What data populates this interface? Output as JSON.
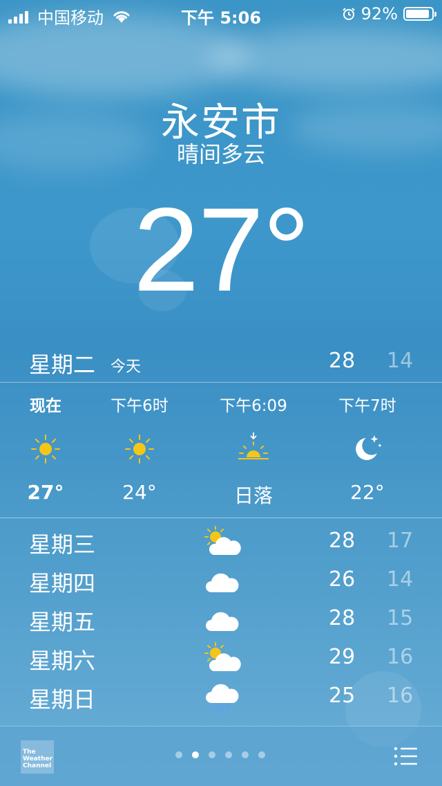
{
  "status_bar": {
    "carrier": "中国移动",
    "time": "下午 5:06",
    "battery": "92%",
    "battery_level": 0.92,
    "signal_bars": 4
  },
  "weather": {
    "city": "永安市",
    "condition": "晴间多云",
    "temperature": "27°"
  },
  "today": {
    "day": "星期二",
    "label": "今天",
    "high": "28",
    "low": "14"
  },
  "hourly": [
    {
      "time": "现在",
      "icon": "sun-icon",
      "temp": "27°"
    },
    {
      "time": "下午6时",
      "icon": "sun-icon",
      "temp": "24°"
    },
    {
      "time": "下午6:09",
      "icon": "sunset-icon",
      "temp": "日落"
    },
    {
      "time": "下午7时",
      "icon": "moon-stars-icon",
      "temp": "22°"
    }
  ],
  "daily": [
    {
      "day": "星期三",
      "icon": "partly-cloudy-icon",
      "high": "28",
      "low": "17"
    },
    {
      "day": "星期四",
      "icon": "cloud-icon",
      "high": "26",
      "low": "14"
    },
    {
      "day": "星期五",
      "icon": "cloud-icon",
      "high": "28",
      "low": "15"
    },
    {
      "day": "星期六",
      "icon": "partly-cloudy-icon",
      "high": "29",
      "low": "16"
    },
    {
      "day": "星期日",
      "icon": "cloud-rain-icon",
      "high": "25",
      "low": "16"
    }
  ],
  "bottom_bar": {
    "logo_text": "The Weather Channel",
    "page_count": 6,
    "active_page": 1
  },
  "colors": {
    "sun": "#f5c518",
    "low_temp": "rgba(255,255,255,0.5)",
    "rain": "#5aa0ff"
  }
}
